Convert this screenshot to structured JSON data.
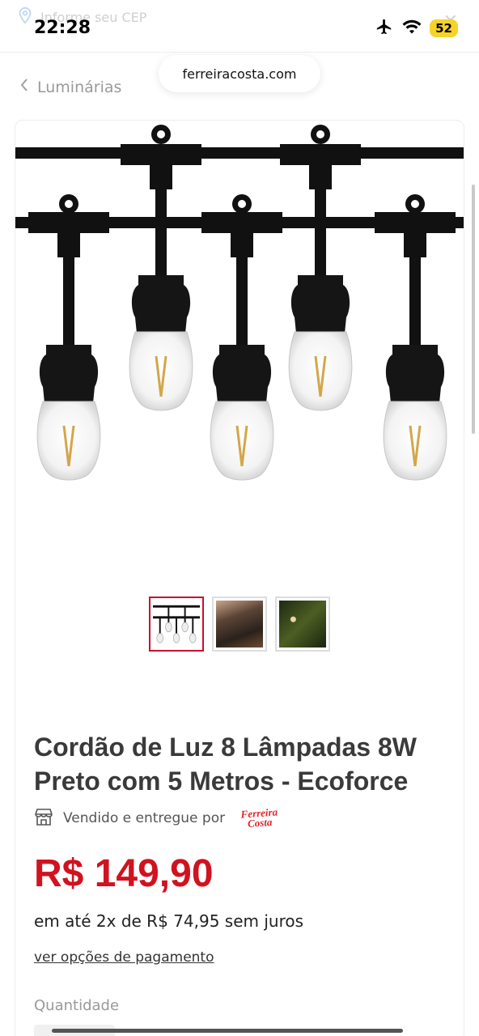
{
  "status_bar": {
    "time": "22:28",
    "battery": "52",
    "icons": [
      "airplane-icon",
      "wifi-icon",
      "battery-icon"
    ]
  },
  "header": {
    "cep_placeholder": "Informe seu CEP",
    "url": "ferreiracosta.com"
  },
  "breadcrumb": {
    "label": "Luminárias"
  },
  "product": {
    "title": "Cordão de Luz 8 Lâmpadas 8W Preto com 5 Metros - Ecoforce",
    "seller_prefix": "Vendido e entregue por",
    "seller_logo_text": "Ferreira Costa",
    "price": "R$ 149,90",
    "installments": "em até 2x de R$ 74,95 sem juros",
    "payment_options_link": "ver opções de pagamento",
    "quantity_label": "Quantidade",
    "selected_thumbnail": 1
  },
  "colors": {
    "accent_red": "#d1121f",
    "thumbnail_active_border": "#c8102e"
  }
}
